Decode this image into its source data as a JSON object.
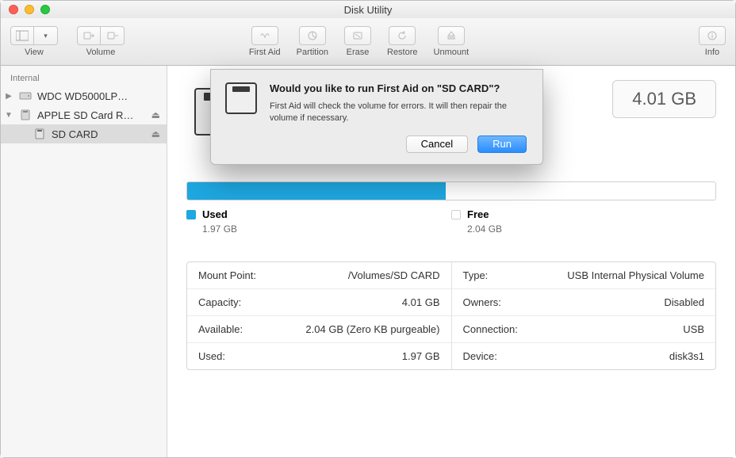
{
  "window": {
    "title": "Disk Utility"
  },
  "toolbar": {
    "view_label": "View",
    "volume_label": "Volume",
    "first_aid_label": "First Aid",
    "partition_label": "Partition",
    "erase_label": "Erase",
    "restore_label": "Restore",
    "unmount_label": "Unmount",
    "info_label": "Info"
  },
  "sidebar": {
    "section": "Internal",
    "items": [
      {
        "label": "WDC WD5000LP…",
        "expanded": false,
        "ejectable": false
      },
      {
        "label": "APPLE SD Card R…",
        "expanded": true,
        "ejectable": true,
        "children": [
          {
            "label": "SD CARD",
            "ejectable": true,
            "selected": true
          }
        ]
      }
    ]
  },
  "hero": {
    "capacity_display": "4.01 GB"
  },
  "usage": {
    "used_label": "Used",
    "used_value": "1.97 GB",
    "free_label": "Free",
    "free_value": "2.04 GB",
    "used_fraction": 0.49
  },
  "details": {
    "left": [
      {
        "label": "Mount Point:",
        "value": "/Volumes/SD CARD"
      },
      {
        "label": "Capacity:",
        "value": "4.01 GB"
      },
      {
        "label": "Available:",
        "value": "2.04 GB (Zero KB purgeable)"
      },
      {
        "label": "Used:",
        "value": "1.97 GB"
      }
    ],
    "right": [
      {
        "label": "Type:",
        "value": "USB Internal Physical Volume"
      },
      {
        "label": "Owners:",
        "value": "Disabled"
      },
      {
        "label": "Connection:",
        "value": "USB"
      },
      {
        "label": "Device:",
        "value": "disk3s1"
      }
    ]
  },
  "dialog": {
    "heading": "Would you like to run First Aid on \"SD CARD\"?",
    "description": "First Aid will check the volume for errors. It will then repair the volume if necessary.",
    "cancel_label": "Cancel",
    "run_label": "Run"
  }
}
